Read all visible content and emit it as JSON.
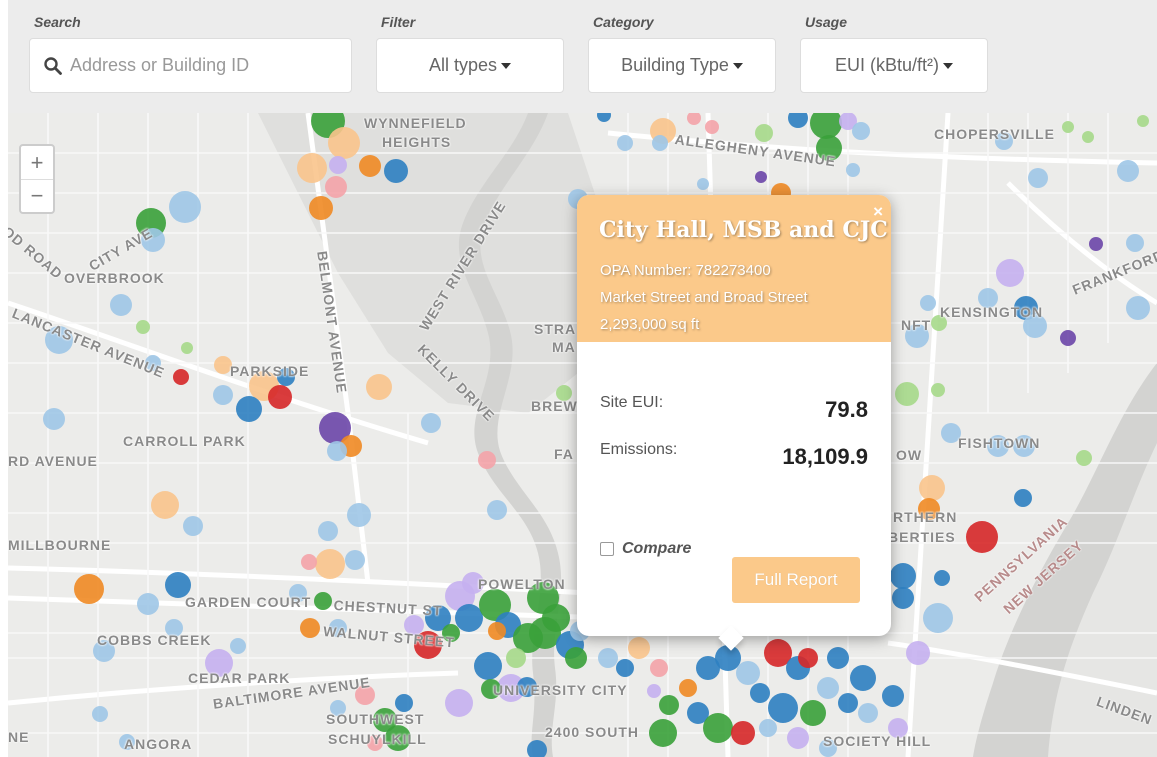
{
  "controls": {
    "search": {
      "label": "Search",
      "placeholder": "Address or Building ID",
      "value": ""
    },
    "filter": {
      "label": "Filter",
      "selected": "All types"
    },
    "category": {
      "label": "Category",
      "selected": "Building Type"
    },
    "usage": {
      "label": "Usage",
      "selected": "EUI (kBtu/ft²)"
    }
  },
  "map": {
    "zoom_in": "+",
    "zoom_out": "−",
    "labels": [
      {
        "text": "WYNNEFIELD",
        "cls": "wynnefield"
      },
      {
        "text": "HEIGHTS",
        "cls": "heights"
      },
      {
        "text": "OVERBROOK",
        "cls": "overbrook"
      },
      {
        "text": "PARKSIDE",
        "cls": "parkside"
      },
      {
        "text": "CARROLL PARK",
        "cls": "carroll"
      },
      {
        "text": "MILLBOURNE",
        "cls": "millbourne"
      },
      {
        "text": "GARDEN COURT",
        "cls": "garden"
      },
      {
        "text": "COBBS CREEK",
        "cls": "cobbs"
      },
      {
        "text": "CEDAR PARK",
        "cls": "cedar"
      },
      {
        "text": "POWELTON",
        "cls": "powelton"
      },
      {
        "text": "CHOPERSVILLE",
        "cls": "chopersville"
      },
      {
        "text": "KENSINGTON",
        "cls": "kensington"
      },
      {
        "text": "FISHTOWN",
        "cls": "fishtown"
      },
      {
        "text": "SOCIETY HILL",
        "cls": "society"
      },
      {
        "text": "SOUTHWEST",
        "cls": "southwest"
      },
      {
        "text": "SCHUYLKILL",
        "cls": "schuylkill"
      },
      {
        "text": "ANGORA",
        "cls": "angora"
      },
      {
        "text": "2400 SOUTH",
        "cls": "south2400"
      },
      {
        "text": "UNIVERSITY CITY",
        "cls": "ucity"
      },
      {
        "text": "STRA",
        "cls": "stra"
      },
      {
        "text": "MA",
        "cls": "ma"
      },
      {
        "text": "BREW",
        "cls": "brew"
      },
      {
        "text": "FA",
        "cls": "fa"
      },
      {
        "text": "NFT",
        "cls": "nft"
      },
      {
        "text": "OW",
        "cls": "ow"
      },
      {
        "text": "RTHERN",
        "cls": "northern"
      },
      {
        "text": "BERTIES",
        "cls": "liberties"
      },
      {
        "text": "RD AVENUE",
        "cls": "rdave"
      },
      {
        "text": "NE",
        "cls": "ne"
      },
      {
        "text": "CITY AVE",
        "cls": "cityave",
        "rot": -30
      },
      {
        "text": "LANCASTER AVENUE",
        "cls": "lancaster",
        "rot": 22
      },
      {
        "text": "BELMONT AVENUE",
        "cls": "belmont",
        "rot": 82
      },
      {
        "text": "WEST RIVER DRIVE",
        "cls": "westriver",
        "rot": -58
      },
      {
        "text": "KELLY DRIVE",
        "cls": "kelly",
        "rot": 45
      },
      {
        "text": "ALLEGHENY AVENUE",
        "cls": "allegheny",
        "rot": 8
      },
      {
        "text": "FRANKFORD",
        "cls": "frankford",
        "rot": -22
      },
      {
        "text": "BALTIMORE AVENUE",
        "cls": "baltimore",
        "rot": -8
      },
      {
        "text": "CHESTNUT ST",
        "cls": "chestnut",
        "rot": 3
      },
      {
        "text": "WALNUT STREET",
        "cls": "walnut",
        "rot": 5
      },
      {
        "text": "PENNSYLVANIA",
        "cls": "penn",
        "rot": -42
      },
      {
        "text": "NEW JERSEY",
        "cls": "nj",
        "rot": -42
      },
      {
        "text": "LINDEN",
        "cls": "linden",
        "rot": 20
      },
      {
        "text": "OD ROAD",
        "cls": "odroad",
        "rot": 40
      }
    ]
  },
  "popup": {
    "title": "City Hall, MSB and CJC",
    "opa": "OPA Number: 782273400",
    "address": "Market Street and Broad Street",
    "area": "2,293,000 sq ft",
    "close": "×",
    "site_eui_label": "Site EUI:",
    "site_eui_value": "79.8",
    "emissions_label": "Emissions:",
    "emissions_value": "18,109.9",
    "compare_label": "Compare",
    "full_report_label": "Full Report"
  },
  "colors": {
    "popup_header": "#fbc98a",
    "map_bg": "#ececea",
    "river": "#d5d5d3",
    "park": "#dededc",
    "dot_palette": [
      "#2e7fc1",
      "#9fc7e7",
      "#3aa13a",
      "#a6d98a",
      "#f08a24",
      "#f9c48c",
      "#d62728",
      "#f4a3a8",
      "#6b46a8",
      "#c5b0f0"
    ]
  }
}
